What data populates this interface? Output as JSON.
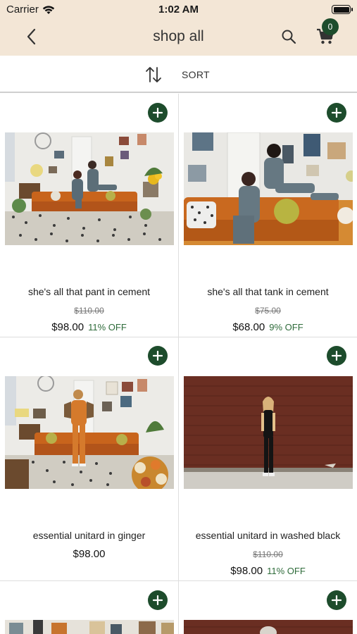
{
  "status": {
    "carrier": "Carrier",
    "time": "1:02 AM"
  },
  "nav": {
    "title": "shop all",
    "cart_count": "0"
  },
  "sort": {
    "label": "SORT"
  },
  "products": [
    {
      "name": "she's all that pant in cement",
      "original_price": "$110.00",
      "price": "$98.00",
      "discount": "11% OFF"
    },
    {
      "name": "she's all that tank in cement",
      "original_price": "$75.00",
      "price": "$68.00",
      "discount": "9% OFF"
    },
    {
      "name": "essential unitard in ginger",
      "original_price": "",
      "price": "$98.00",
      "discount": ""
    },
    {
      "name": "essential unitard in washed black",
      "original_price": "$110.00",
      "price": "$98.00",
      "discount": "11% OFF"
    }
  ],
  "colors": {
    "header_bg": "#f3e6d6",
    "accent": "#1d4c2c",
    "discount": "#2e6b3a"
  }
}
